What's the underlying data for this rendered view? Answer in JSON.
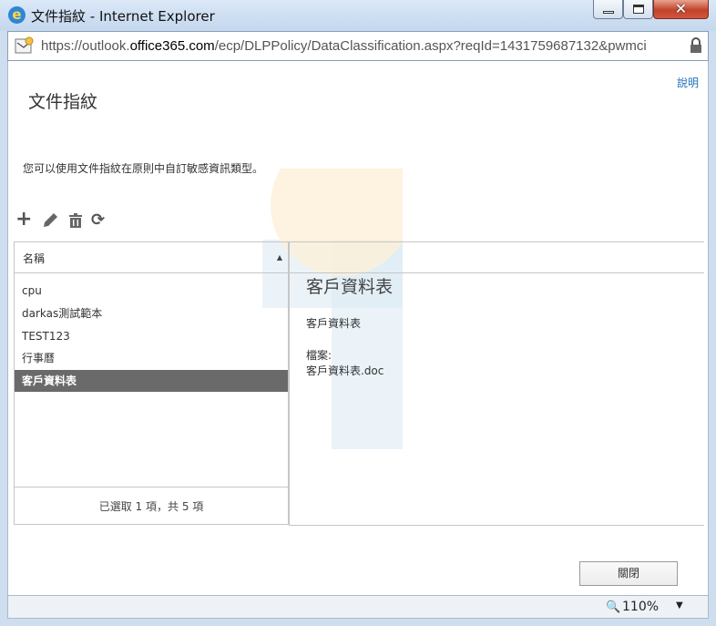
{
  "window": {
    "title": "文件指紋 - Internet Explorer",
    "close_glyph": "✕"
  },
  "address": {
    "url_prefix": "https://outlook.",
    "url_host": "office365.com",
    "url_path": "/ecp/DLPPolicy/DataClassification.aspx?reqId=1431759687132&pwmci"
  },
  "page": {
    "help": "說明",
    "heading": "文件指紋",
    "description": "您可以使用文件指紋在原則中自訂敏感資訊類型。"
  },
  "toolbar": {
    "add_glyph": "+",
    "refresh_glyph": "⟳"
  },
  "list": {
    "column_name": "名稱",
    "sort_glyph": "▲",
    "items": [
      {
        "label": "cpu"
      },
      {
        "label": "darkas測試範本"
      },
      {
        "label": "TEST123"
      },
      {
        "label": "行事曆"
      },
      {
        "label": "客戶資料表",
        "selected": true
      }
    ],
    "footer": "已選取 1 項，共 5 項"
  },
  "detail": {
    "title": "客戶資料表",
    "subtitle": "客戶資料表",
    "file_label": "檔案:",
    "file_name": "客戶資料表.doc"
  },
  "buttons": {
    "close": "關閉"
  },
  "status": {
    "zoom_icon": "🔍",
    "zoom": "110%",
    "zoom_arrow": "▼"
  }
}
